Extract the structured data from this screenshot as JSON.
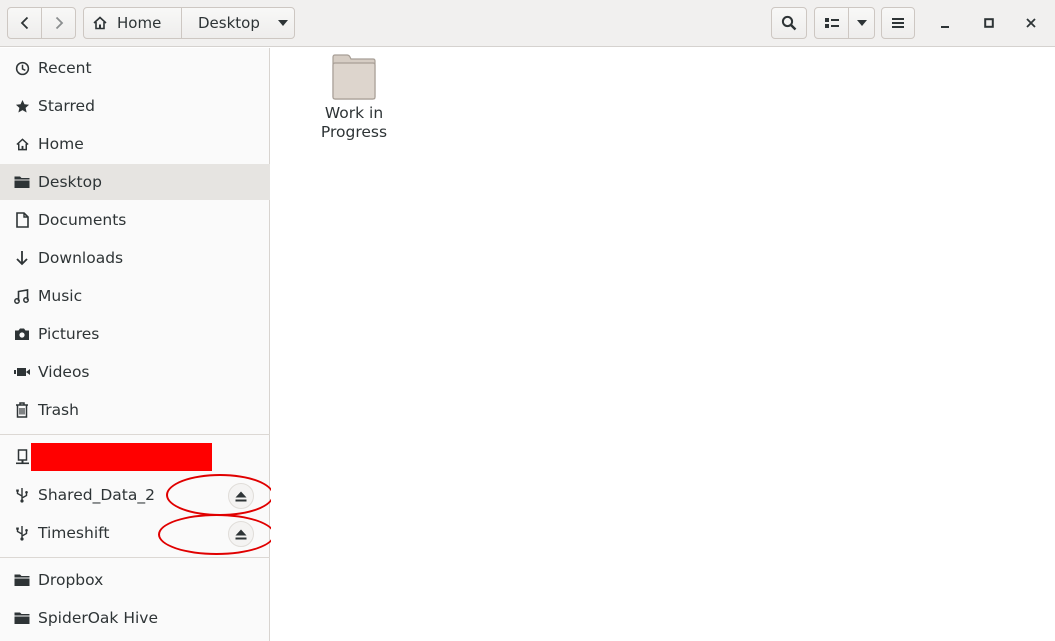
{
  "header": {
    "path": [
      "Home",
      "Desktop"
    ]
  },
  "sidebar": {
    "places": [
      {
        "label": "Recent",
        "icon": "clock-icon"
      },
      {
        "label": "Starred",
        "icon": "star-icon"
      },
      {
        "label": "Home",
        "icon": "home-icon"
      },
      {
        "label": "Desktop",
        "icon": "folder-icon",
        "active": true
      },
      {
        "label": "Documents",
        "icon": "document-icon"
      },
      {
        "label": "Downloads",
        "icon": "download-icon"
      },
      {
        "label": "Music",
        "icon": "music-icon"
      },
      {
        "label": "Pictures",
        "icon": "camera-icon"
      },
      {
        "label": "Videos",
        "icon": "video-icon"
      },
      {
        "label": "Trash",
        "icon": "trash-icon"
      }
    ],
    "devices": [
      {
        "label": "",
        "icon": "network-drive-icon",
        "redacted": true
      },
      {
        "label": "Shared_Data_2",
        "icon": "usb-icon"
      },
      {
        "label": "Timeshift",
        "icon": "usb-icon"
      }
    ],
    "bookmarks": [
      {
        "label": "Dropbox",
        "icon": "folder-icon"
      },
      {
        "label": "SpiderOak Hive",
        "icon": "folder-icon"
      }
    ]
  },
  "main": {
    "items": [
      {
        "label": "Work in Progress",
        "icon": "folder-icon"
      }
    ]
  },
  "colors": {
    "header_bg": "#f1f0ef",
    "sidebar_bg": "#fafafa",
    "active_bg": "#e6e4e1",
    "folder": "#d6cdc4",
    "annotation_red": "#e00000",
    "redaction_red": "#ff0000"
  }
}
